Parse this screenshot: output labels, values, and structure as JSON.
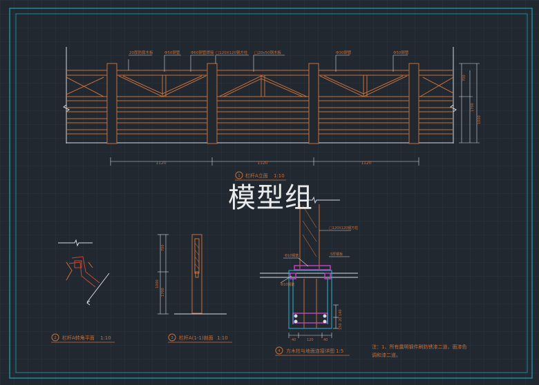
{
  "watermark": "模型组",
  "colors": {
    "background": "#212830",
    "grid": "#2c3540",
    "frame": "#1f8a9a",
    "line_white": "#d8dde2",
    "line_orange": "#c9703a",
    "line_red": "#c34a3a",
    "line_magenta": "#c040c0",
    "line_cyan": "#2ab6d6"
  },
  "elevation": {
    "callouts": [
      "20厚防腐木板",
      "Φ50钢管",
      "Φ60钢管焊接",
      "□120X120钢方柱",
      "□20x50钢木板",
      "Φ30钢管",
      "Φ50钢管"
    ],
    "spans": [
      "1120",
      "1120",
      "1120"
    ],
    "right_dims": [
      "700",
      "1700",
      "1000"
    ],
    "title": "栏杆A立面",
    "scale": "1:10",
    "title_number": "1"
  },
  "corner_plan": {
    "title": "栏杆A转角平面",
    "scale": "1:10",
    "title_number": "2"
  },
  "section": {
    "title": "栏杆A(1-1)剖面",
    "scale": "1:10",
    "title_number": "3",
    "dims": [
      "700",
      "1700",
      "1000"
    ]
  },
  "post_detail": {
    "title": "方木柱与地面连接详图",
    "scale": "1:5",
    "title_number": "4",
    "labels": [
      "□120X120钢方柱",
      "Φ10钢筋",
      "5厚钢板",
      "Φ10钢筋"
    ],
    "bottom_dims": [
      "40",
      "120",
      "40"
    ],
    "right_dims": [
      "140",
      "20",
      "150"
    ]
  },
  "notes": {
    "line1": "注：1、所有露明钢件刷防锈漆二道，面漆色",
    "line2": "调和漆二道。"
  }
}
